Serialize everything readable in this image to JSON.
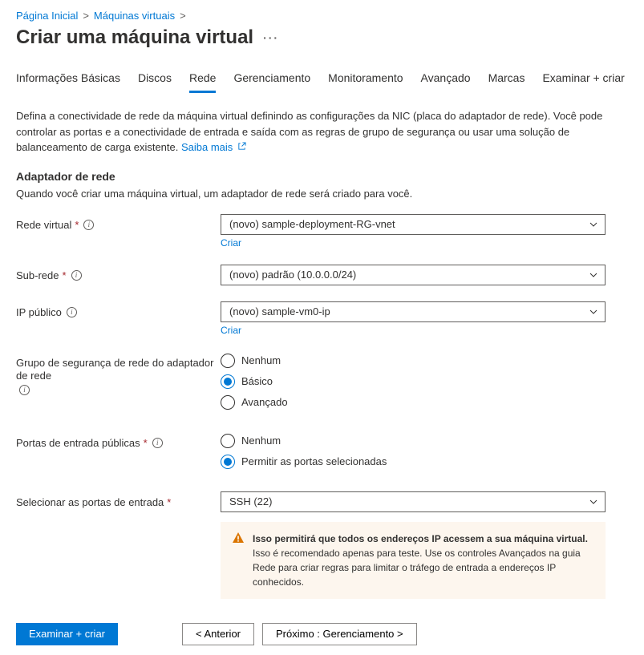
{
  "breadcrumb": {
    "home": "Página Inicial",
    "vms": "Máquinas virtuais"
  },
  "title": "Criar uma máquina virtual",
  "tabs": [
    "Informações Básicas",
    "Discos",
    "Rede",
    "Gerenciamento",
    "Monitoramento",
    "Avançado",
    "Marcas",
    "Examinar + criar"
  ],
  "active_tab": "Rede",
  "description": "Defina a conectividade de rede da máquina virtual definindo as configurações da NIC (placa do adaptador de rede). Você pode controlar as portas e a conectividade de entrada e saída com as regras de grupo de segurança ou usar uma solução de balanceamento de carga existente.",
  "learn_more": "Saiba mais",
  "section": {
    "title": "Adaptador de rede",
    "subtitle": "Quando você criar uma máquina virtual, um adaptador de rede será criado para você."
  },
  "fields": {
    "vnet": {
      "label": "Rede virtual",
      "value": "(novo) sample-deployment-RG-vnet",
      "create": "Criar"
    },
    "subnet": {
      "label": "Sub-rede",
      "value": "(novo) padrão (10.0.0.0/24)"
    },
    "publicip": {
      "label": "IP público",
      "value": "(novo) sample-vm0-ip",
      "create": "Criar"
    },
    "nsg": {
      "label": "Grupo de segurança de rede do adaptador de rede",
      "options": {
        "none": "Nenhum",
        "basic": "Básico",
        "advanced": "Avançado"
      }
    },
    "inbound": {
      "label": "Portas de entrada públicas",
      "options": {
        "none": "Nenhum",
        "allow": "Permitir as portas selecionadas"
      }
    },
    "select_ports": {
      "label": "Selecionar as portas de entrada",
      "value": "SSH (22)"
    }
  },
  "warning": {
    "bold": "Isso permitirá que todos os endereços IP acessem a sua máquina virtual.",
    "rest": " Isso é recomendado apenas para teste. Use os controles Avançados na guia Rede para criar regras para limitar o tráfego de entrada a endereços IP conhecidos."
  },
  "footer": {
    "review": "Examinar + criar",
    "prev": "<  Anterior",
    "next": "Próximo : Gerenciamento  >"
  }
}
